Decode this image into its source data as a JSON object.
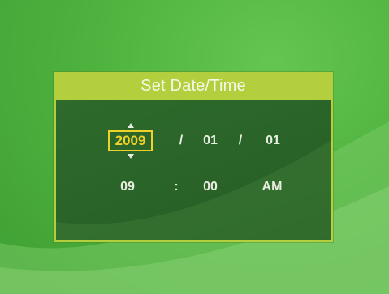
{
  "dialog": {
    "title": "Set Date/Time",
    "date": {
      "year": "2009",
      "separator1": "/",
      "month": "01",
      "separator2": "/",
      "day": "01"
    },
    "time": {
      "hour": "09",
      "separator": ":",
      "minute": "00",
      "ampm": "AM"
    }
  },
  "colors": {
    "background": "#4fb33f",
    "dialog_frame": "#b3cf3e",
    "dialog_body": "#2a6328",
    "highlight": "#f0d12a",
    "text": "#e7eee0"
  },
  "icons": {
    "up": "triangle-up-icon",
    "down": "triangle-down-icon"
  }
}
